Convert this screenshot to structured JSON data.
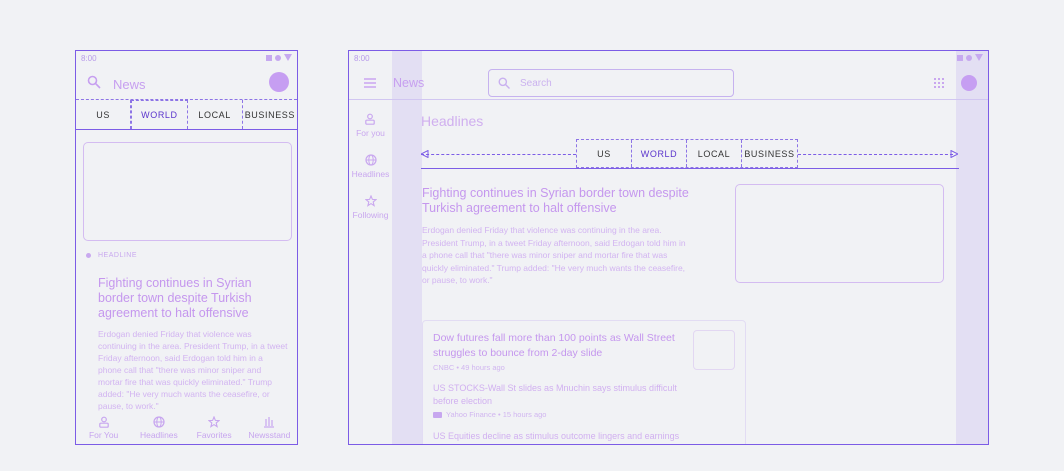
{
  "phone": {
    "status_time": "8:00",
    "app_title": "News",
    "tabs": [
      {
        "label": "US",
        "active": false
      },
      {
        "label": "WORLD",
        "active": true
      },
      {
        "label": "LOCAL",
        "active": false
      },
      {
        "label": "BUSINESS",
        "active": false
      }
    ],
    "section_label": "HEADLINE",
    "story": {
      "title": "Fighting continues in Syrian border town despite Turkish agreement to halt offensive",
      "body": "Erdogan denied Friday that violence was continuing in the area. President Trump, in a tweet Friday afternoon, said Erdogan told him in a phone call that \"there was minor sniper and mortar fire that was quickly eliminated.\" Trump added: \"He very much wants the ceasefire, or pause, to work.\""
    },
    "bottom_nav": [
      {
        "label": "For You",
        "icon": "person-icon"
      },
      {
        "label": "Headlines",
        "icon": "globe-icon"
      },
      {
        "label": "Favorites",
        "icon": "star-icon"
      },
      {
        "label": "Newsstand",
        "icon": "newsstand-icon"
      }
    ]
  },
  "tablet": {
    "status_time": "8:00",
    "app_title": "News",
    "search_placeholder": "Search",
    "nav": [
      {
        "label": "For you",
        "icon": "person-icon"
      },
      {
        "label": "Headlines",
        "icon": "globe-icon"
      },
      {
        "label": "Following",
        "icon": "star-icon"
      }
    ],
    "section_title": "Headlines",
    "tabs": [
      {
        "label": "US",
        "active": false
      },
      {
        "label": "WORLD",
        "active": true
      },
      {
        "label": "LOCAL",
        "active": false
      },
      {
        "label": "BUSINESS",
        "active": false
      }
    ],
    "story": {
      "title": "Fighting continues in Syrian border town despite Turkish agreement to halt offensive",
      "body": "Erdogan denied Friday that violence was continuing in the area. President Trump, in a tweet Friday afternoon, said Erdogan told him in a phone call that \"there was minor sniper and mortar fire that was quickly eliminated.\" Trump added: \"He very much wants the ceasefire, or pause, to work.\""
    },
    "card": {
      "title": "Dow futures fall more than 100 points as Wall Street struggles to bounce from 2-day slide",
      "meta": "CNBC • 49 hours ago",
      "sub1": "US STOCKS-Wall St slides as Mnuchin says stimulus difficult before election",
      "sub1_meta": "Yahoo Finance • 15 hours ago",
      "sub2": "US Equities decline as stimulus outcome lingers and earnings"
    }
  },
  "colors": {
    "frame": "#7c5ce6",
    "accent_text": "#c597ee",
    "active_tab": "#5b34cc",
    "background": "#f1f2f5"
  }
}
